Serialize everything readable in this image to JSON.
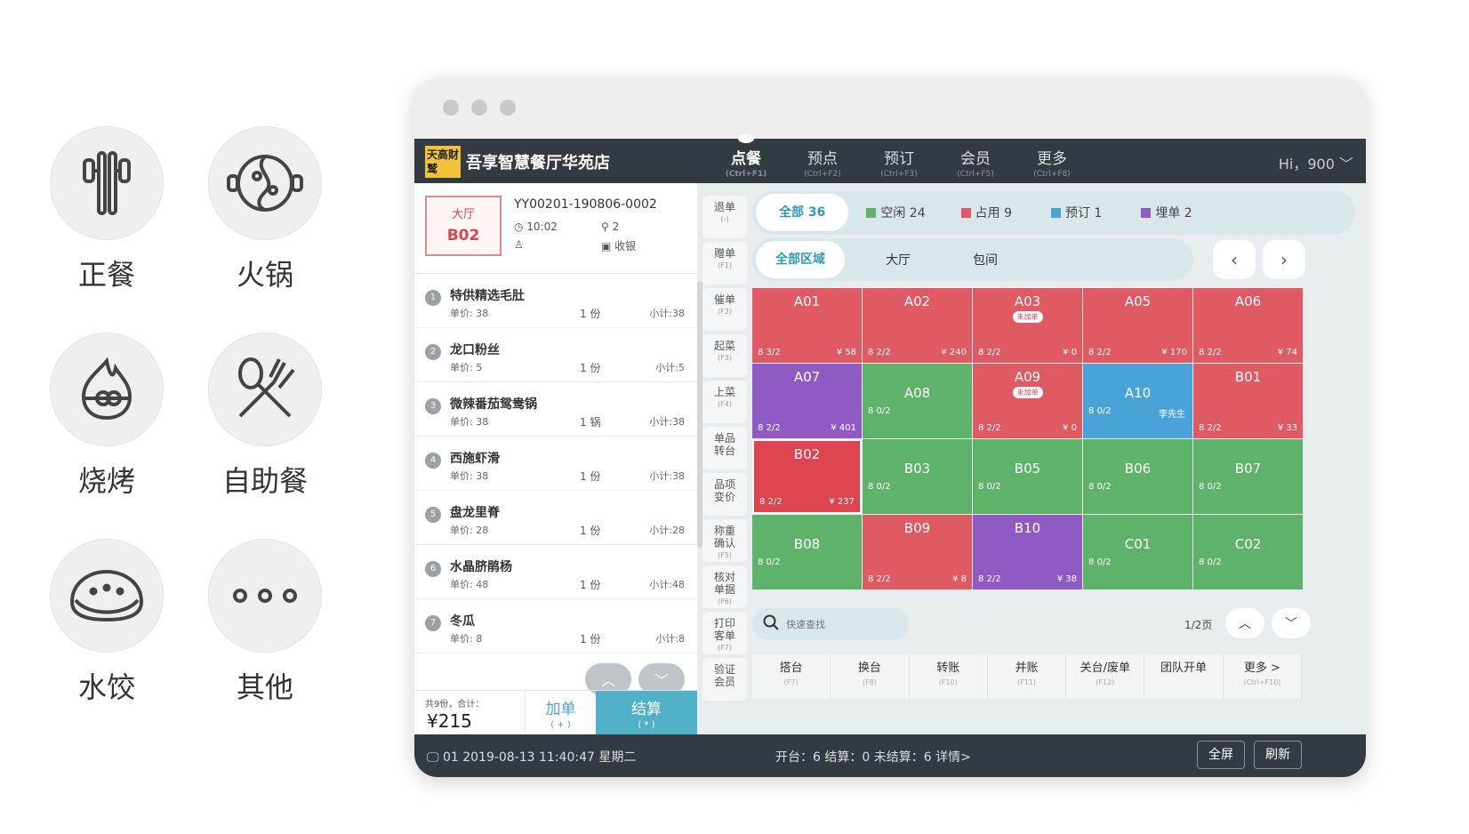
{
  "categories": [
    {
      "label": "正餐",
      "icon": "chopsticks-icon"
    },
    {
      "label": "火锅",
      "icon": "hotpot-icon"
    },
    {
      "label": "烧烤",
      "icon": "bbq-skewer-icon"
    },
    {
      "label": "自助餐",
      "icon": "fork-spoon-icon"
    },
    {
      "label": "水饺",
      "icon": "dumpling-icon"
    },
    {
      "label": "其他",
      "icon": "more-dots-icon"
    }
  ],
  "app": {
    "logo": "天高财鹫",
    "store": "吾享智慧餐厅华苑店",
    "nav": [
      {
        "label": "点餐",
        "key": "(Ctrl+F1)",
        "active": true
      },
      {
        "label": "预点",
        "key": "(Ctrl+F2)",
        "active": false
      },
      {
        "label": "预订",
        "key": "(Ctrl+F3)",
        "active": false
      },
      {
        "label": "会员",
        "key": "(Ctrl+F5)",
        "active": false
      },
      {
        "label": "更多",
        "key": "(Ctrl+F8)",
        "active": false
      }
    ],
    "user": "Hi，900 ﹀"
  },
  "order": {
    "area": "大厅",
    "table": "B02",
    "order_no": "YY00201-190806-0002",
    "time": "10:02",
    "guests": "2",
    "person": "",
    "cashier": "收银",
    "items": [
      {
        "idx": "1",
        "name": "特供精选毛肚",
        "price": "单价: 38",
        "qty": "1 份",
        "subtotal": "小计:38"
      },
      {
        "idx": "2",
        "name": "龙口粉丝",
        "price": "单价: 5",
        "qty": "1 份",
        "subtotal": "小计:5"
      },
      {
        "idx": "3",
        "name": "微辣番茄鸳鸯锅",
        "price": "单价: 38",
        "qty": "1 锅",
        "subtotal": "小计:38"
      },
      {
        "idx": "4",
        "name": "西施虾滑",
        "price": "单价: 38",
        "qty": "1 份",
        "subtotal": "小计:38"
      },
      {
        "idx": "5",
        "name": "盘龙里脊",
        "price": "单价: 28",
        "qty": "1 份",
        "subtotal": "小计:28"
      },
      {
        "idx": "6",
        "name": "水晶脐鹃杨",
        "price": "单价: 48",
        "qty": "1 份",
        "subtotal": "小计:48"
      },
      {
        "idx": "7",
        "name": "冬瓜",
        "price": "单价: 8",
        "qty": "1 份",
        "subtotal": "小计:8"
      }
    ],
    "total_label": "共9份，合计：",
    "total": "¥215",
    "add_label": "加单",
    "add_key": "( + )",
    "pay_label": "结算",
    "pay_key": "( * )",
    "up": "︿",
    "down": "﹀"
  },
  "actions": [
    {
      "label": "退单",
      "key": "(-)"
    },
    {
      "label": "赠单",
      "key": "(F1)"
    },
    {
      "label": "催单",
      "key": "(F2)"
    },
    {
      "label": "起菜",
      "key": "(F3)"
    },
    {
      "label": "上菜",
      "key": "(F4)"
    },
    {
      "label": "单品\n转台",
      "key": ""
    },
    {
      "label": "品项\n变价",
      "key": ""
    },
    {
      "label": "称重\n确认",
      "key": "(F5)"
    },
    {
      "label": "核对\n单据",
      "key": "(F6)"
    },
    {
      "label": "打印\n客单",
      "key": "(F7)"
    },
    {
      "label": "验证\n会员",
      "key": ""
    }
  ],
  "filters": {
    "all": "全部 36",
    "legend": [
      {
        "label": "空闲 24",
        "color": "#5fb26a"
      },
      {
        "label": "占用 9",
        "color": "#e05a63"
      },
      {
        "label": "预订 1",
        "color": "#4aa3d8"
      },
      {
        "label": "埋单 2",
        "color": "#8f5ac4"
      }
    ],
    "zone_all": "全部区域",
    "zones": [
      "大厅",
      "包间"
    ],
    "prev": "‹",
    "next": "›"
  },
  "colors": {
    "free": "#5fb26a",
    "occupied": "#e05a63",
    "reserved": "#4aa3d8",
    "paid": "#8f5ac4",
    "selected": "#de4450"
  },
  "tables": [
    {
      "code": "A01",
      "status": "occupied",
      "guests": "8 3/2",
      "amount": "¥ 58",
      "tag": ""
    },
    {
      "code": "A02",
      "status": "occupied",
      "guests": "8 2/2",
      "amount": "¥ 240",
      "tag": ""
    },
    {
      "code": "A03",
      "status": "occupied",
      "guests": "8 2/2",
      "amount": "¥ 0",
      "tag": "未加单"
    },
    {
      "code": "A05",
      "status": "occupied",
      "guests": "8 2/2",
      "amount": "¥ 170",
      "tag": ""
    },
    {
      "code": "A06",
      "status": "occupied",
      "guests": "8 2/2",
      "amount": "¥ 74",
      "tag": ""
    },
    {
      "code": "A07",
      "status": "paid",
      "guests": "8 2/2",
      "amount": "¥ 401",
      "tag": ""
    },
    {
      "code": "A08",
      "status": "free",
      "guests": "8 0/2",
      "amount": "",
      "tag": ""
    },
    {
      "code": "A09",
      "status": "occupied",
      "guests": "8 2/2",
      "amount": "¥ 0",
      "tag": "未加单"
    },
    {
      "code": "A10",
      "status": "reserved",
      "guests": "8 0/2",
      "amount": "",
      "tag": "",
      "who": "李先生"
    },
    {
      "code": "B01",
      "status": "occupied",
      "guests": "8 2/2",
      "amount": "¥ 33",
      "tag": ""
    },
    {
      "code": "B02",
      "status": "selected",
      "guests": "8 2/2",
      "amount": "¥ 237",
      "tag": ""
    },
    {
      "code": "B03",
      "status": "free",
      "guests": "8 0/2",
      "amount": "",
      "tag": ""
    },
    {
      "code": "B05",
      "status": "free",
      "guests": "8 0/2",
      "amount": "",
      "tag": ""
    },
    {
      "code": "B06",
      "status": "free",
      "guests": "8 0/2",
      "amount": "",
      "tag": ""
    },
    {
      "code": "B07",
      "status": "free",
      "guests": "8 0/2",
      "amount": "",
      "tag": ""
    },
    {
      "code": "B08",
      "status": "free",
      "guests": "8 0/2",
      "amount": "",
      "tag": ""
    },
    {
      "code": "B09",
      "status": "occupied",
      "guests": "8 2/2",
      "amount": "¥ 8",
      "tag": ""
    },
    {
      "code": "B10",
      "status": "paid",
      "guests": "8 2/2",
      "amount": "¥ 38",
      "tag": ""
    },
    {
      "code": "C01",
      "status": "free",
      "guests": "8 0/2",
      "amount": "",
      "tag": ""
    },
    {
      "code": "C02",
      "status": "free",
      "guests": "8 0/2",
      "amount": "",
      "tag": ""
    }
  ],
  "search": {
    "placeholder": "快速查找"
  },
  "page_indicator": "1/2页",
  "ops": [
    {
      "label": "搭台",
      "key": "(F7)"
    },
    {
      "label": "换台",
      "key": "(F8)"
    },
    {
      "label": "转账",
      "key": "(F10)"
    },
    {
      "label": "并账",
      "key": "(F11)"
    },
    {
      "label": "关台/废单",
      "key": "(F12)"
    },
    {
      "label": "团队开单",
      "key": ""
    },
    {
      "label": "更多 >",
      "key": "(Ctrl+F10)"
    }
  ],
  "status": {
    "left": "01  2019-08-13  11:40:47  星期二",
    "mid": "开台：6    结算：0    未结算：6    详情>",
    "fullscreen": "全屏",
    "refresh": "刷新"
  }
}
